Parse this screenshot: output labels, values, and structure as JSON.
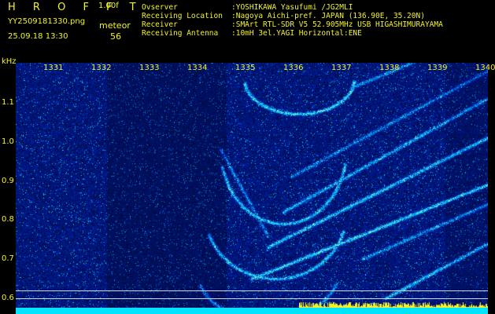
{
  "header": {
    "app_title": "H R O F F T",
    "version": "1.00f",
    "filename": "YY2509181330.png",
    "datetime": "25.09.18 13:30",
    "meteor_label": "meteor",
    "meteor_count": "56"
  },
  "station": [
    {
      "key": "Ovserver",
      "value": ":YOSHIKAWA Yasufumi /JG2MLI"
    },
    {
      "key": "Receiving Location",
      "value": ":Nagoya Aichi-pref. JAPAN (136.90E, 35.20N)"
    },
    {
      "key": "Receiver",
      "value": ":SMArt RTL-SDR V5 52.905MHz USB HIGASHIMURAYAMA"
    },
    {
      "key": "Receiving Antenna",
      "value": ":10mH 3el.YAGI Horizontal:ENE"
    }
  ],
  "y_axis": {
    "unit": "kHz",
    "ticks": [
      "1.1",
      "1.0",
      "0.9",
      "0.8",
      "0.7",
      "0.6"
    ]
  },
  "x_axis": {
    "ticks": [
      "1331",
      "1332",
      "1333",
      "1334",
      "1335",
      "1336",
      "1337",
      "1338",
      "1339",
      "1340"
    ]
  },
  "colors": {
    "text": "#f2f22a",
    "background": "#000000",
    "noise_floor": "#0a0fa0",
    "signal": "#33c0ff",
    "baseline": "#00e4ff"
  }
}
